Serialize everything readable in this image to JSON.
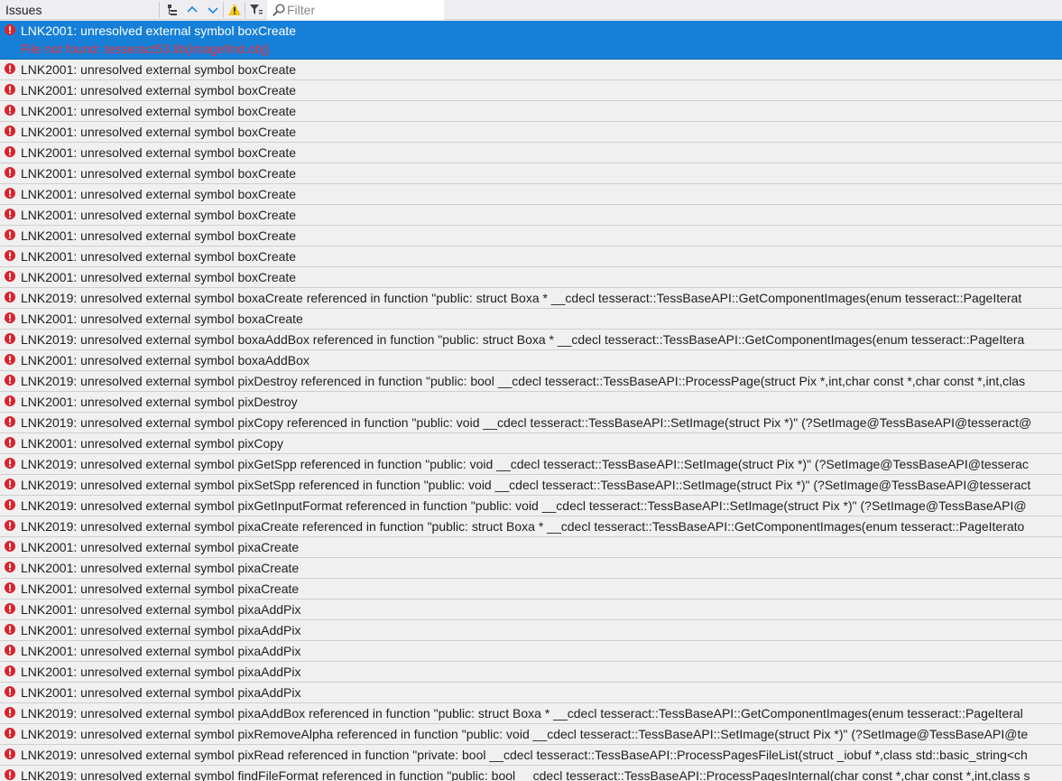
{
  "toolbar": {
    "title": "Issues",
    "filter_placeholder": "Filter",
    "buttons": [
      {
        "name": "group-by-icon"
      },
      {
        "name": "previous-issue-icon"
      },
      {
        "name": "next-issue-icon"
      },
      {
        "name": "warning-filter-icon"
      },
      {
        "name": "filter-settings-icon"
      }
    ]
  },
  "colors": {
    "selected_bg": "#1680d8",
    "error_icon": "#d9232d",
    "detail_text": "#e8323c"
  },
  "issues": [
    {
      "text": "LNK2001: unresolved external symbol boxCreate",
      "detail": "File not found: tesseract53.lib(imagefind.obj)",
      "selected": true
    },
    {
      "text": "LNK2001: unresolved external symbol boxCreate"
    },
    {
      "text": "LNK2001: unresolved external symbol boxCreate"
    },
    {
      "text": "LNK2001: unresolved external symbol boxCreate"
    },
    {
      "text": "LNK2001: unresolved external symbol boxCreate"
    },
    {
      "text": "LNK2001: unresolved external symbol boxCreate"
    },
    {
      "text": "LNK2001: unresolved external symbol boxCreate"
    },
    {
      "text": "LNK2001: unresolved external symbol boxCreate"
    },
    {
      "text": "LNK2001: unresolved external symbol boxCreate"
    },
    {
      "text": "LNK2001: unresolved external symbol boxCreate"
    },
    {
      "text": "LNK2001: unresolved external symbol boxCreate"
    },
    {
      "text": "LNK2001: unresolved external symbol boxCreate"
    },
    {
      "text": "LNK2019: unresolved external symbol boxaCreate referenced in function \"public: struct Boxa * __cdecl tesseract::TessBaseAPI::GetComponentImages(enum tesseract::PageIterat"
    },
    {
      "text": "LNK2001: unresolved external symbol boxaCreate"
    },
    {
      "text": "LNK2019: unresolved external symbol boxaAddBox referenced in function \"public: struct Boxa * __cdecl tesseract::TessBaseAPI::GetComponentImages(enum tesseract::PageItera"
    },
    {
      "text": "LNK2001: unresolved external symbol boxaAddBox"
    },
    {
      "text": "LNK2019: unresolved external symbol pixDestroy referenced in function \"public: bool __cdecl tesseract::TessBaseAPI::ProcessPage(struct Pix *,int,char const *,char const *,int,clas"
    },
    {
      "text": "LNK2001: unresolved external symbol pixDestroy"
    },
    {
      "text": "LNK2019: unresolved external symbol pixCopy referenced in function \"public: void __cdecl tesseract::TessBaseAPI::SetImage(struct Pix *)\" (?SetImage@TessBaseAPI@tesseract@"
    },
    {
      "text": "LNK2001: unresolved external symbol pixCopy"
    },
    {
      "text": "LNK2019: unresolved external symbol pixGetSpp referenced in function \"public: void __cdecl tesseract::TessBaseAPI::SetImage(struct Pix *)\" (?SetImage@TessBaseAPI@tesserac"
    },
    {
      "text": "LNK2019: unresolved external symbol pixSetSpp referenced in function \"public: void __cdecl tesseract::TessBaseAPI::SetImage(struct Pix *)\" (?SetImage@TessBaseAPI@tesseract"
    },
    {
      "text": "LNK2019: unresolved external symbol pixGetInputFormat referenced in function \"public: void __cdecl tesseract::TessBaseAPI::SetImage(struct Pix *)\" (?SetImage@TessBaseAPI@"
    },
    {
      "text": "LNK2019: unresolved external symbol pixaCreate referenced in function \"public: struct Boxa * __cdecl tesseract::TessBaseAPI::GetComponentImages(enum tesseract::PageIterato"
    },
    {
      "text": "LNK2001: unresolved external symbol pixaCreate"
    },
    {
      "text": "LNK2001: unresolved external symbol pixaCreate"
    },
    {
      "text": "LNK2001: unresolved external symbol pixaCreate"
    },
    {
      "text": "LNK2001: unresolved external symbol pixaAddPix"
    },
    {
      "text": "LNK2001: unresolved external symbol pixaAddPix"
    },
    {
      "text": "LNK2001: unresolved external symbol pixaAddPix"
    },
    {
      "text": "LNK2001: unresolved external symbol pixaAddPix"
    },
    {
      "text": "LNK2001: unresolved external symbol pixaAddPix"
    },
    {
      "text": "LNK2019: unresolved external symbol pixaAddBox referenced in function \"public: struct Boxa * __cdecl tesseract::TessBaseAPI::GetComponentImages(enum tesseract::PageIteral"
    },
    {
      "text": "LNK2019: unresolved external symbol pixRemoveAlpha referenced in function \"public: void __cdecl tesseract::TessBaseAPI::SetImage(struct Pix *)\" (?SetImage@TessBaseAPI@te"
    },
    {
      "text": "LNK2019: unresolved external symbol pixRead referenced in function \"private: bool __cdecl tesseract::TessBaseAPI::ProcessPagesFileList(struct _iobuf *,class std::basic_string<ch"
    },
    {
      "text": "LNK2019: unresolved external symbol findFileFormat referenced in function \"public: bool __cdecl tesseract::TessBaseAPI::ProcessPagesInternal(char const *,char const *,int,class s"
    }
  ]
}
